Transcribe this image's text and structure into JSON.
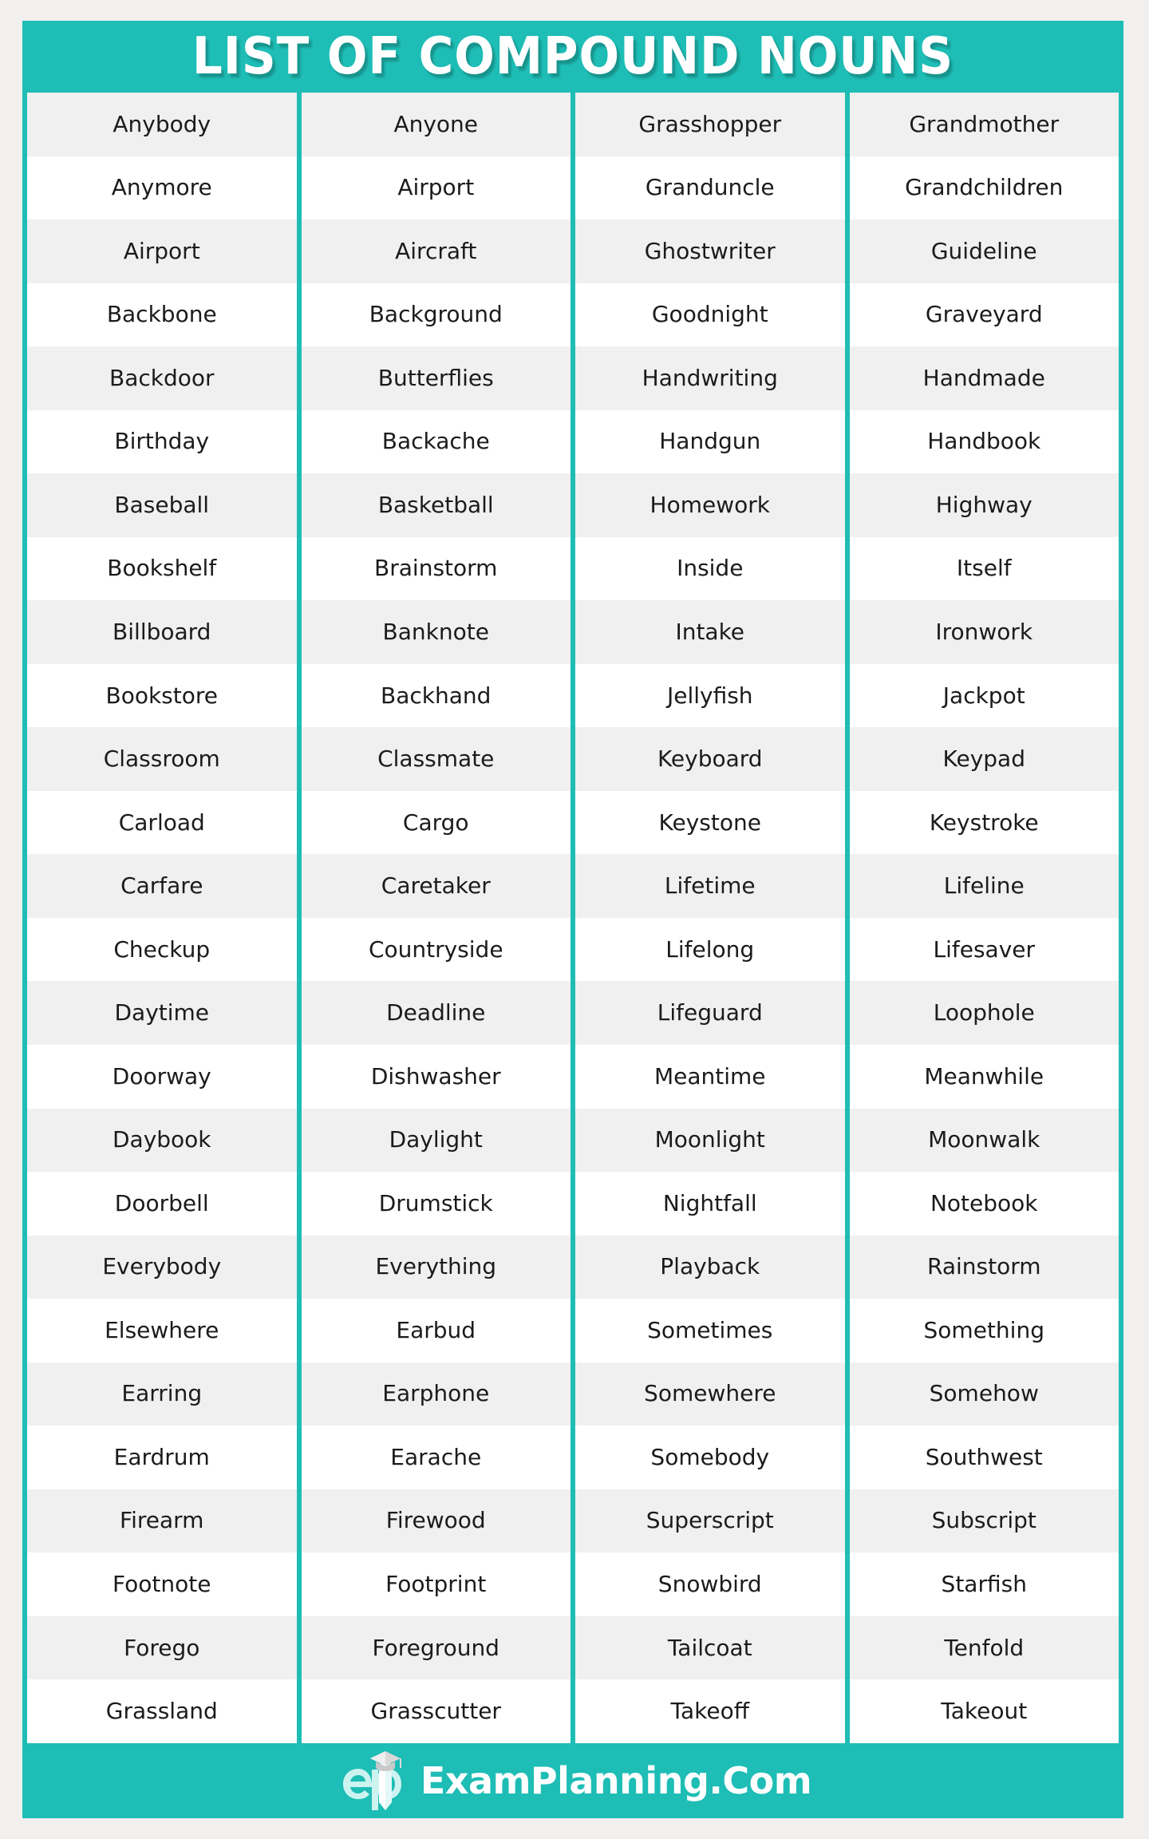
{
  "page": {
    "background_color": "#f1f0ef",
    "accent_color": "#1ebdb5",
    "row_alt_color": "#f0f0f0",
    "text_color": "#1b1b1b"
  },
  "header": {
    "title": "LIST OF COMPOUND NOUNS"
  },
  "footer": {
    "logo_mark": "ep-graduation-cap-logo",
    "brand": "ExamPlanning.Com"
  },
  "table": {
    "row_count": 28,
    "column_count": 4,
    "columns": [
      {
        "index": 1,
        "cells": [
          "Anybody",
          "Anymore",
          "Airport",
          "Backbone",
          "Backdoor",
          "Birthday",
          "Baseball",
          "Bookshelf",
          "Billboard",
          "Bookstore",
          "Classroom",
          "Carload",
          "Carfare",
          "Checkup",
          "Daytime",
          "Doorway",
          "Daybook",
          "Doorbell",
          "Everybody",
          "Elsewhere",
          "Earring",
          "Eardrum",
          "Firearm",
          "Footnote",
          "Forego",
          "Grassland"
        ]
      },
      {
        "index": 2,
        "cells": [
          "Anyone",
          "Airport",
          "Aircraft",
          "Background",
          "Butterflies",
          "Backache",
          "Basketball",
          "Brainstorm",
          "Banknote",
          "Backhand",
          "Classmate",
          "Cargo",
          "Caretaker",
          "Countryside",
          "Deadline",
          "Dishwasher",
          "Daylight",
          "Drumstick",
          "Everything",
          "Earbud",
          "Earphone",
          "Earache",
          "Firewood",
          "Footprint",
          "Foreground",
          "Grasscutter"
        ]
      },
      {
        "index": 3,
        "cells": [
          "Grasshopper",
          "Granduncle",
          "Ghostwriter",
          "Goodnight",
          "Handwriting",
          "Handgun",
          "Homework",
          "Inside",
          "Intake",
          "Jellyfish",
          "Keyboard",
          "Keystone",
          "Lifetime",
          "Lifelong",
          "Lifeguard",
          "Meantime",
          "Moonlight",
          "Nightfall",
          "Playback",
          "Sometimes",
          "Somewhere",
          "Somebody",
          "Superscript",
          "Snowbird",
          "Tailcoat",
          "Takeoff"
        ]
      },
      {
        "index": 4,
        "cells": [
          "Grandmother",
          "Grandchildren",
          "Guideline",
          "Graveyard",
          "Handmade",
          "Handbook",
          "Highway",
          "Itself",
          "Ironwork",
          "Jackpot",
          "Keypad",
          "Keystroke",
          "Lifeline",
          "Lifesaver",
          "Loophole",
          "Meanwhile",
          "Moonwalk",
          "Notebook",
          "Rainstorm",
          "Something",
          "Somehow",
          "Southwest",
          "Subscript",
          "Starfish",
          "Tenfold",
          "Takeout"
        ]
      }
    ]
  }
}
